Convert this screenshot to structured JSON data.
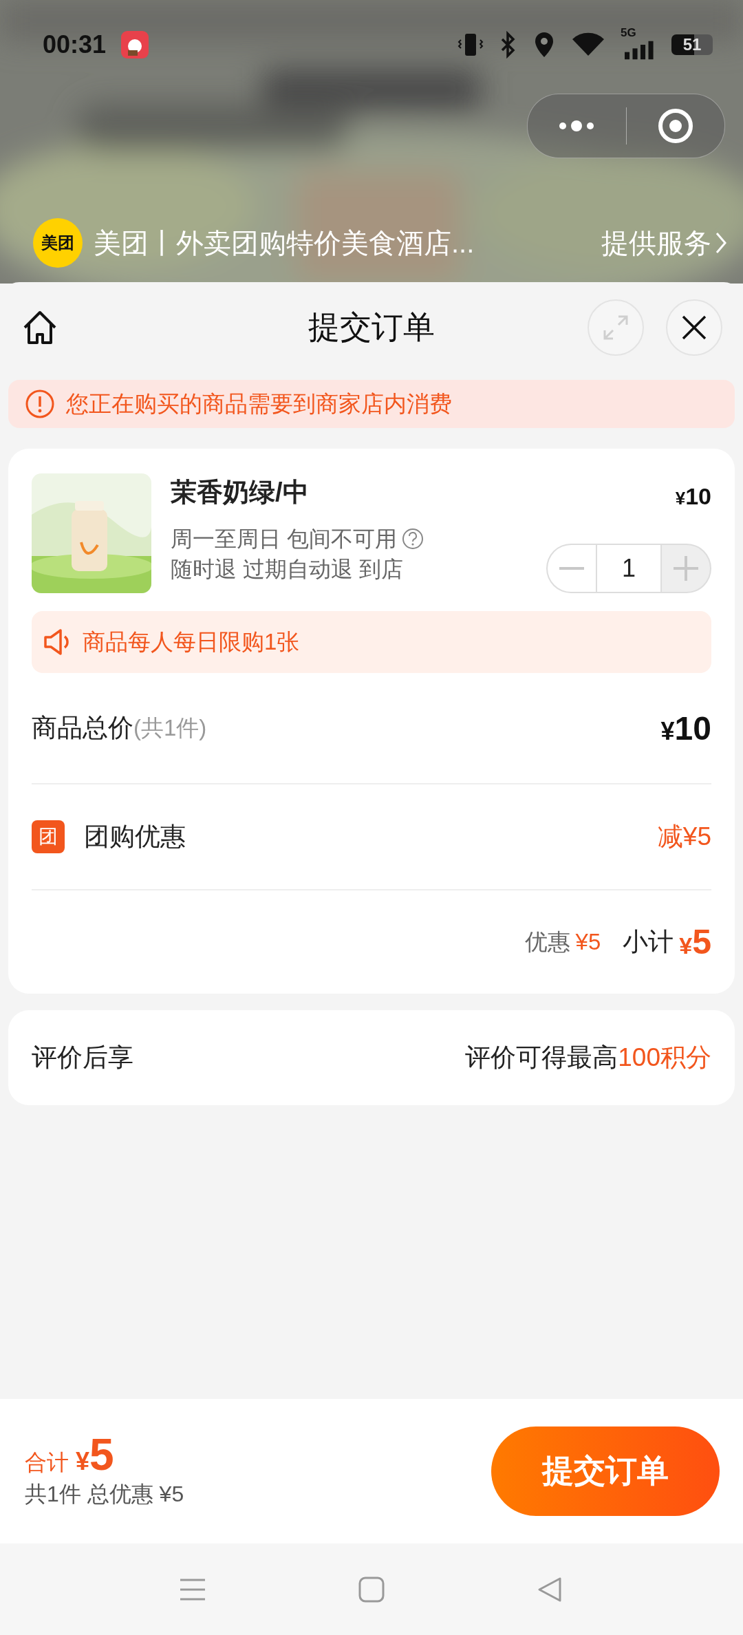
{
  "status_bar": {
    "time": "00:31",
    "network": "5G",
    "battery": "51"
  },
  "mini_app": {
    "logo": "美团",
    "name": "美团丨外卖团购特价美食酒店...",
    "service": "提供服务"
  },
  "header": {
    "title": "提交订单"
  },
  "notice": "您正在购买的商品需要到商家店内消费",
  "product": {
    "name": "茉香奶绿/中",
    "price": "¥10",
    "usage": "周一至周日 包间不可用",
    "policy": "随时退 过期自动退 到店",
    "quantity": "1",
    "minus_disabled": true,
    "plus_disabled": true
  },
  "limit": "商品每人每日限购1张",
  "summary": {
    "total_label": "商品总价",
    "total_count": "(共1件)",
    "total_value": "¥10",
    "discount_badge": "团",
    "discount_label": "团购优惠",
    "discount_value": "减¥5",
    "saving_label": "优惠",
    "saving_value": "¥5",
    "subtotal_label": "小计",
    "subtotal_value": "¥5"
  },
  "review": {
    "label": "评价后享",
    "text": "评价可得最高",
    "highlight": "100积分"
  },
  "footer": {
    "total_label": "合计",
    "total_value": "¥5",
    "detail": "共1件 总优惠 ¥5",
    "submit": "提交订单"
  }
}
